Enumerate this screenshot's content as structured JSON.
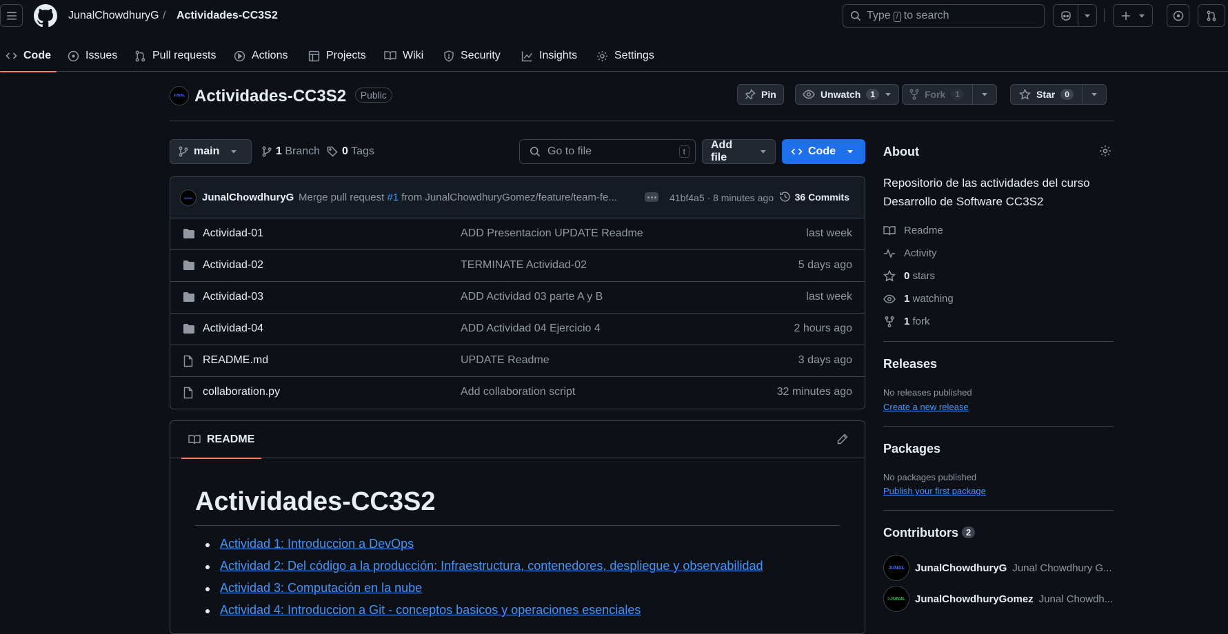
{
  "header": {
    "owner": "JunalChowdhuryG",
    "separator": "/",
    "repo": "Actividades-CC3S2",
    "search": {
      "before": "Type",
      "key": "/",
      "after": "to search"
    }
  },
  "tabs": [
    {
      "label": "Code",
      "icon": "code-icon",
      "active": true
    },
    {
      "label": "Issues",
      "icon": "issue-icon"
    },
    {
      "label": "Pull requests",
      "icon": "pull-request-icon"
    },
    {
      "label": "Actions",
      "icon": "play-icon"
    },
    {
      "label": "Projects",
      "icon": "table-icon"
    },
    {
      "label": "Wiki",
      "icon": "book-icon"
    },
    {
      "label": "Security",
      "icon": "shield-icon"
    },
    {
      "label": "Insights",
      "icon": "graph-icon"
    },
    {
      "label": "Settings",
      "icon": "gear-icon"
    }
  ],
  "repo_header": {
    "avatar_text": "JUNAL",
    "title": "Actividades-CC3S2",
    "visibility": "Public",
    "pin_label": "Pin",
    "unwatch_label": "Unwatch",
    "watch_count": "1",
    "fork_label": "Fork",
    "fork_count": "1",
    "star_label": "Star",
    "star_count": "0"
  },
  "toolbar": {
    "branch": "main",
    "branch_count": "1",
    "branch_label": "Branch",
    "tag_count": "0",
    "tag_label": "Tags",
    "goto_placeholder": "Go to file",
    "goto_key": "t",
    "add_file_label": "Add file",
    "code_label": "Code"
  },
  "latest_commit": {
    "author": "JunalChowdhuryG",
    "message_prefix": "Merge pull request",
    "pr_ref": "#1",
    "message_suffix": "from JunalChowdhuryGomez/feature/team-fe...",
    "sha": "41bf4a5",
    "dot": "·",
    "time": "8 minutes ago",
    "commits_count": "36 Commits"
  },
  "files": [
    {
      "type": "folder",
      "name": "Actividad-01",
      "message": "ADD Presentacion UPDATE Readme",
      "date": "last week"
    },
    {
      "type": "folder",
      "name": "Actividad-02",
      "message": "TERMINATE Actividad-02",
      "date": "5 days ago"
    },
    {
      "type": "folder",
      "name": "Actividad-03",
      "message": "ADD Actividad 03 parte A y B",
      "date": "last week"
    },
    {
      "type": "folder",
      "name": "Actividad-04",
      "message": "ADD Actividad 04 Ejercicio 4",
      "date": "2 hours ago"
    },
    {
      "type": "file",
      "name": "README.md",
      "message": "UPDATE Readme",
      "date": "3 days ago"
    },
    {
      "type": "file",
      "name": "collaboration.py",
      "message": "Add collaboration script",
      "date": "32 minutes ago"
    }
  ],
  "readme": {
    "tab_label": "README",
    "heading": "Actividades-CC3S2",
    "links": [
      "Actividad 1: Introduccion a DevOps",
      "Actividad 2: Del código a la producción: Infraestructura, contenedores, despliegue y observabilidad",
      "Actividad 3: Computación en la nube",
      "Actividad 4: Introduccion a Git - conceptos basicos y operaciones esenciales"
    ]
  },
  "about": {
    "title": "About",
    "description": "Repositorio de las actividades del curso Desarrollo de Software CC3S2",
    "readme_label": "Readme",
    "activity_label": "Activity",
    "stars_count": "0",
    "stars_label": "stars",
    "watching_count": "1",
    "watching_label": "watching",
    "fork_count": "1",
    "fork_label": "fork"
  },
  "releases": {
    "title": "Releases",
    "empty": "No releases published",
    "link": "Create a new release"
  },
  "packages": {
    "title": "Packages",
    "empty": "No packages published",
    "link": "Publish your first package"
  },
  "contributors": {
    "title": "Contributors",
    "count": "2",
    "list": [
      {
        "login": "JunalChowdhuryG",
        "name": "Junal Chowdhury G...",
        "avatar_text": "JUNAL",
        "avatar_color": "#4a6cff"
      },
      {
        "login": "JunalChowdhuryGomez",
        "name": "Junal Chowdh...",
        "avatar_text": ">JUN4L",
        "avatar_color": "#3fb950"
      }
    ]
  },
  "colors": {
    "accent": "#1f6feb",
    "link": "#4493f8",
    "tab_underline": "#f78166",
    "bg": "#0d1117"
  }
}
